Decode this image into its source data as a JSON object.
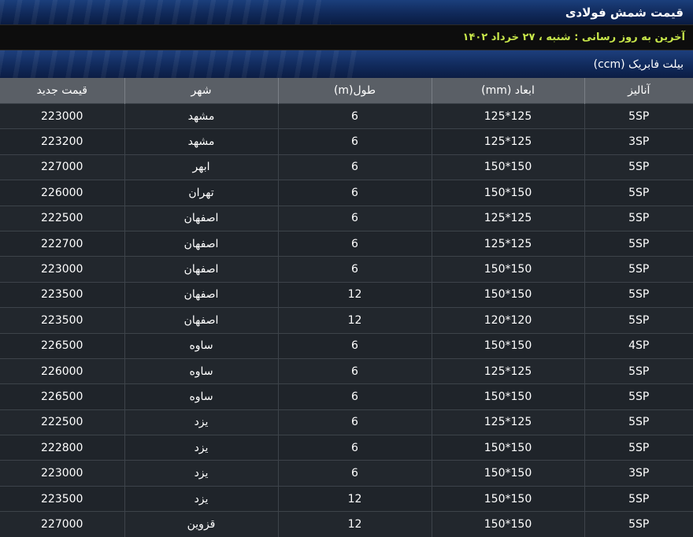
{
  "header": {
    "title": "قیمت شمش فولادی",
    "update_text": "آخرین به روز رسانی : شنبه ، ۲۷ خرداد ۱۴۰۲",
    "section_title": "بیلت فابریک (ccm)"
  },
  "table": {
    "columns": [
      "آنالیز",
      "ابعاد (mm)",
      "طول(m)",
      "شهر",
      "قیمت جدید"
    ],
    "rows": [
      {
        "analysis": "5SP",
        "dim": "125*125",
        "len": "6",
        "city": "مشهد",
        "price": "223000"
      },
      {
        "analysis": "3SP",
        "dim": "125*125",
        "len": "6",
        "city": "مشهد",
        "price": "223200"
      },
      {
        "analysis": "5SP",
        "dim": "150*150",
        "len": "6",
        "city": "ابهر",
        "price": "227000"
      },
      {
        "analysis": "5SP",
        "dim": "150*150",
        "len": "6",
        "city": "تهران",
        "price": "226000"
      },
      {
        "analysis": "5SP",
        "dim": "125*125",
        "len": "6",
        "city": "اصفهان",
        "price": "222500"
      },
      {
        "analysis": "5SP",
        "dim": "125*125",
        "len": "6",
        "city": "اصفهان",
        "price": "222700"
      },
      {
        "analysis": "5SP",
        "dim": "150*150",
        "len": "6",
        "city": "اصفهان",
        "price": "223000"
      },
      {
        "analysis": "5SP",
        "dim": "150*150",
        "len": "12",
        "city": "اصفهان",
        "price": "223500"
      },
      {
        "analysis": "5SP",
        "dim": "120*120",
        "len": "12",
        "city": "اصفهان",
        "price": "223500"
      },
      {
        "analysis": "4SP",
        "dim": "150*150",
        "len": "6",
        "city": "ساوه",
        "price": "226500"
      },
      {
        "analysis": "5SP",
        "dim": "125*125",
        "len": "6",
        "city": "ساوه",
        "price": "226000"
      },
      {
        "analysis": "5SP",
        "dim": "150*150",
        "len": "6",
        "city": "ساوه",
        "price": "226500"
      },
      {
        "analysis": "5SP",
        "dim": "125*125",
        "len": "6",
        "city": "یزد",
        "price": "222500"
      },
      {
        "analysis": "5SP",
        "dim": "150*150",
        "len": "6",
        "city": "یزد",
        "price": "222800"
      },
      {
        "analysis": "3SP",
        "dim": "150*150",
        "len": "6",
        "city": "یزد",
        "price": "223000"
      },
      {
        "analysis": "5SP",
        "dim": "150*150",
        "len": "12",
        "city": "یزد",
        "price": "223500"
      },
      {
        "analysis": "5SP",
        "dim": "150*150",
        "len": "12",
        "city": "قزوین",
        "price": "227000"
      }
    ]
  }
}
